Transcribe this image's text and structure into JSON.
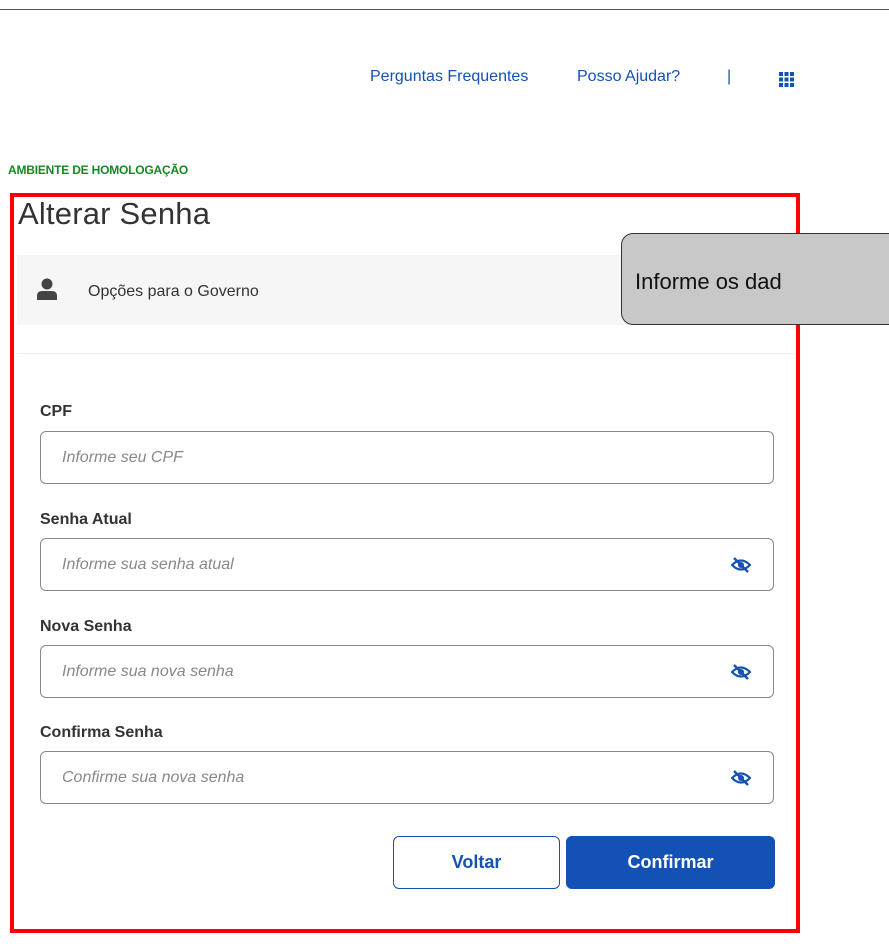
{
  "header": {
    "faq_link": "Perguntas Frequentes",
    "help_link": "Posso Ajudar?",
    "separator": "|",
    "apps_icon": "grid-apps-icon"
  },
  "environment_label": "AMBIENTE DE HOMOLOGAÇÃO",
  "page": {
    "title": "Alterar Senha"
  },
  "gov_option": {
    "icon": "user-icon",
    "label": "Opções para o Governo"
  },
  "form": {
    "cpf": {
      "label": "CPF",
      "placeholder": "Informe seu CPF",
      "value": ""
    },
    "current_password": {
      "label": "Senha Atual",
      "placeholder": "Informe sua senha atual",
      "value": "",
      "toggle_icon": "eye-slash-icon"
    },
    "new_password": {
      "label": "Nova Senha",
      "placeholder": "Informe sua nova senha",
      "value": "",
      "toggle_icon": "eye-slash-icon"
    },
    "confirm_password": {
      "label": "Confirma Senha",
      "placeholder": "Confirme sua nova senha",
      "value": "",
      "toggle_icon": "eye-slash-icon"
    }
  },
  "buttons": {
    "back": "Voltar",
    "confirm": "Confirmar"
  },
  "tooltip": {
    "text": "Informe os dad"
  },
  "colors": {
    "primary": "#1351b4",
    "environment": "#168821",
    "highlight_frame": "#ff0000",
    "tooltip_bg": "#c8c8c8"
  }
}
